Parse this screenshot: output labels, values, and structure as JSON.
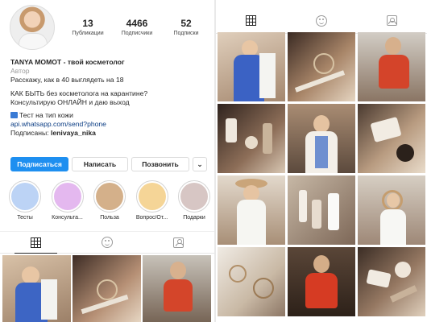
{
  "profile": {
    "stats": [
      {
        "number": "13",
        "label": "Публикации"
      },
      {
        "number": "4466",
        "label": "Подписчики"
      },
      {
        "number": "52",
        "label": "Подписки"
      }
    ],
    "name": "TANYA MOMOT - твой косметолог",
    "category": "Автор",
    "bio_line1": "Расскажу, как в 40 выглядеть на 18",
    "bio_line2": "КАК БЫТЬ без косметолога на карантине?",
    "bio_line3": "Консультирую ОНЛАЙН и даю выход",
    "bio_line4": "Тест на тип кожи",
    "link": "api.whatsapp.com/send?phone",
    "followed_by_prefix": "Подписаны: ",
    "followed_by_user": "lenivaya_nika"
  },
  "buttons": {
    "follow": "Подписаться",
    "message": "Написать",
    "call": "Позвонить",
    "more": "⌄"
  },
  "highlights": [
    {
      "label": "Тесты",
      "color": "#bcd3f5"
    },
    {
      "label": "Консульта...",
      "color": "#e4b8ef"
    },
    {
      "label": "Польза",
      "color": "#d4b08a"
    },
    {
      "label": "Вопрос/От...",
      "color": "#f5d597"
    },
    {
      "label": "Подарки",
      "color": "#d7c6c4"
    }
  ],
  "tabs": {
    "grid": "grid-icon",
    "reels": "smile-icon",
    "tagged": "tagged-icon"
  },
  "colors": {
    "accent": "#1e8ff0",
    "link": "#0b3d84",
    "muted": "#9a9a9a"
  }
}
